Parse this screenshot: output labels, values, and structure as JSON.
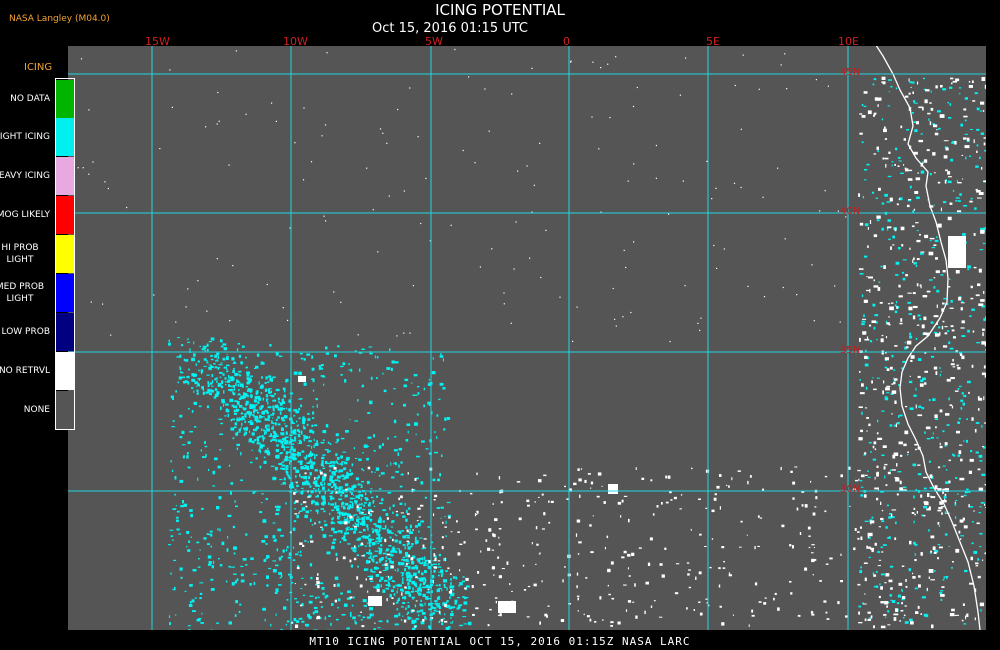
{
  "header": {
    "title": "ICING POTENTIAL",
    "subtitle": "Oct 15, 2016 01:15 UTC",
    "brand": "NASA Langley (M04.0)"
  },
  "map": {
    "longitude_labels": [
      "15W",
      "10W",
      "5W",
      "0",
      "5E",
      "10E"
    ],
    "latitude_labels": [
      "45N",
      "40N",
      "35N",
      "30N"
    ],
    "colors": {
      "background": "#555555",
      "gridlines": "#20d8e0",
      "icing_cells": "#00f4f4",
      "no_retrieval": "#ffffff",
      "coastline": "#ffffff"
    }
  },
  "legend": {
    "title": "ICING",
    "items": [
      {
        "label": "NO DATA",
        "color": "#00b400"
      },
      {
        "label": "NIGHT ICING",
        "color": "#00f0f0"
      },
      {
        "label": "HEAVY ICING",
        "color": "#e8a8e0"
      },
      {
        "label": "MOG LIKELY",
        "color": "#ff0000"
      },
      {
        "label": "HI PROB LIGHT",
        "color": "#ffff00"
      },
      {
        "label": "MED PROB LIGHT",
        "color": "#0000ff"
      },
      {
        "label": "LOW PROB",
        "color": "#000080"
      },
      {
        "label": "NO RETRVL",
        "color": "#ffffff"
      },
      {
        "label": "NONE",
        "color": "#555555"
      }
    ]
  },
  "footer": {
    "text": "MT10  ICING POTENTIAL  OCT 15, 2016 01:15Z  NASA LARC"
  }
}
